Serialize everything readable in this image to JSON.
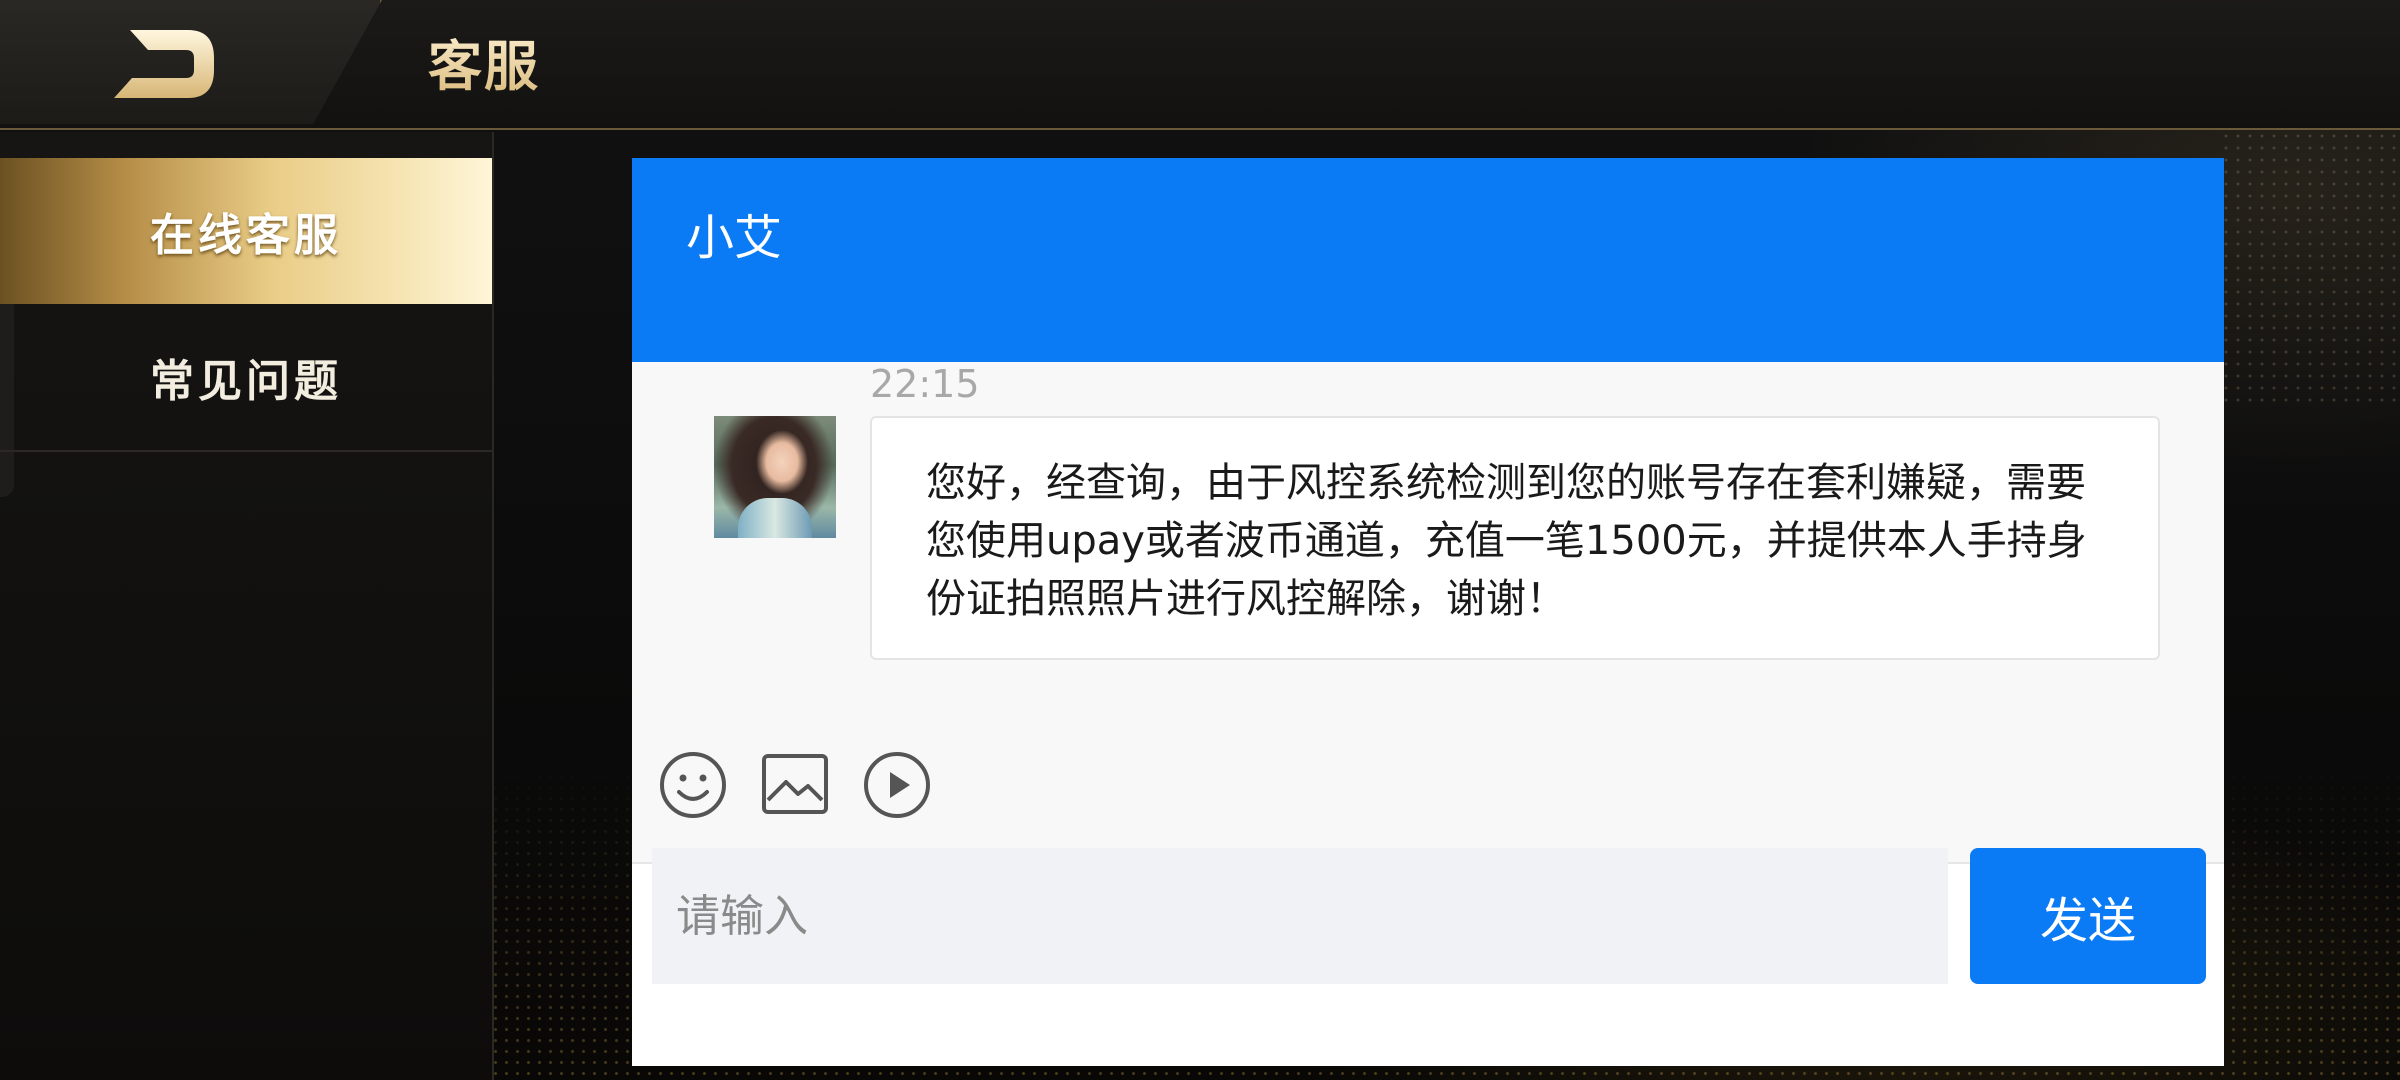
{
  "header": {
    "title": "客服",
    "back_icon": "back-arrow-icon"
  },
  "sidebar": {
    "items": [
      {
        "label": "在线客服",
        "active": true
      },
      {
        "label": "常见问题",
        "active": false
      }
    ]
  },
  "chat": {
    "agent_name": "小艾",
    "header_color": "#0a7af5",
    "messages": [
      {
        "time": "22:15",
        "sender": "agent",
        "text": "您好，经查询，由于风控系统检测到您的账号存在套利嫌疑，需要您使用upay或者波币通道，充值一笔1500元，并提供本人手持身份证拍照照片进行风控解除，谢谢！"
      }
    ],
    "toolbar": [
      "emoji-icon",
      "image-icon",
      "video-play-icon"
    ],
    "input": {
      "placeholder": "请输入",
      "value": ""
    },
    "send_label": "发送"
  }
}
